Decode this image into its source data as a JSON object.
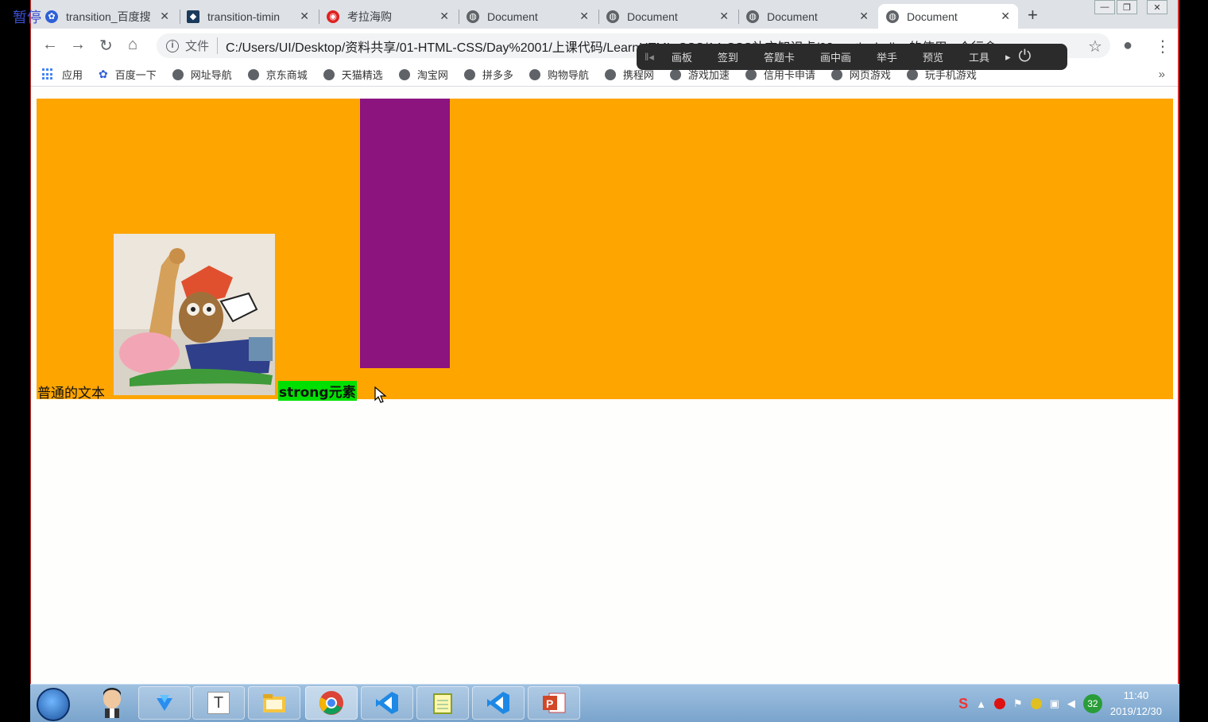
{
  "overlay": {
    "pause_label": "暂停"
  },
  "tabs": [
    {
      "title": "transition_百度搜",
      "icon": "baidu-paw-icon",
      "active": false
    },
    {
      "title": "transition-timin",
      "icon": "mdn-icon",
      "active": false
    },
    {
      "title": "考拉海购",
      "icon": "kaola-icon",
      "active": false
    },
    {
      "title": "Document",
      "icon": "globe-icon",
      "active": false
    },
    {
      "title": "Document",
      "icon": "globe-icon",
      "active": false
    },
    {
      "title": "Document",
      "icon": "globe-icon",
      "active": false
    },
    {
      "title": "Document",
      "icon": "globe-icon",
      "active": true
    }
  ],
  "toolbar": {
    "file_chip": "文件",
    "url": "C:/Users/UI/Desktop/资料共享/01-HTML-CSS/Day%2001/上课代码/LearnHTML-CSS/14-CSS补充知识点/08-vertical-align的使用 - 个行盒"
  },
  "float_toolbar": [
    "画板",
    "签到",
    "答题卡",
    "画中画",
    "举手",
    "预览",
    "工具"
  ],
  "bookmarks": [
    {
      "label": "应用",
      "icon": "apps-grid-icon"
    },
    {
      "label": "百度一下",
      "icon": "baidu-paw-icon"
    },
    {
      "label": "网址导航",
      "icon": "globe-icon"
    },
    {
      "label": "京东商城",
      "icon": "globe-icon"
    },
    {
      "label": "天猫精选",
      "icon": "globe-icon"
    },
    {
      "label": "淘宝网",
      "icon": "globe-icon"
    },
    {
      "label": "拼多多",
      "icon": "globe-icon"
    },
    {
      "label": "购物导航",
      "icon": "globe-icon"
    },
    {
      "label": "携程网",
      "icon": "globe-icon"
    },
    {
      "label": "游戏加速",
      "icon": "globe-icon"
    },
    {
      "label": "信用卡申请",
      "icon": "globe-icon"
    },
    {
      "label": "网页游戏",
      "icon": "globe-icon"
    },
    {
      "label": "玩手机游戏",
      "icon": "globe-icon"
    }
  ],
  "page": {
    "plain_text": "普通的文本",
    "strong_text": "strong元素",
    "colors": {
      "box": "#ffa500",
      "block": "#8b147f",
      "strong_bg": "#00e000"
    }
  },
  "taskbar": {
    "apps": [
      "avatar",
      "feishu-icon",
      "typora-icon",
      "file-explorer-icon",
      "chrome-icon",
      "vscode-icon",
      "notepad-icon",
      "vscode-icon",
      "powerpoint-icon"
    ],
    "tray_badge": "32",
    "time": "11:40",
    "date": "2019/12/30"
  }
}
